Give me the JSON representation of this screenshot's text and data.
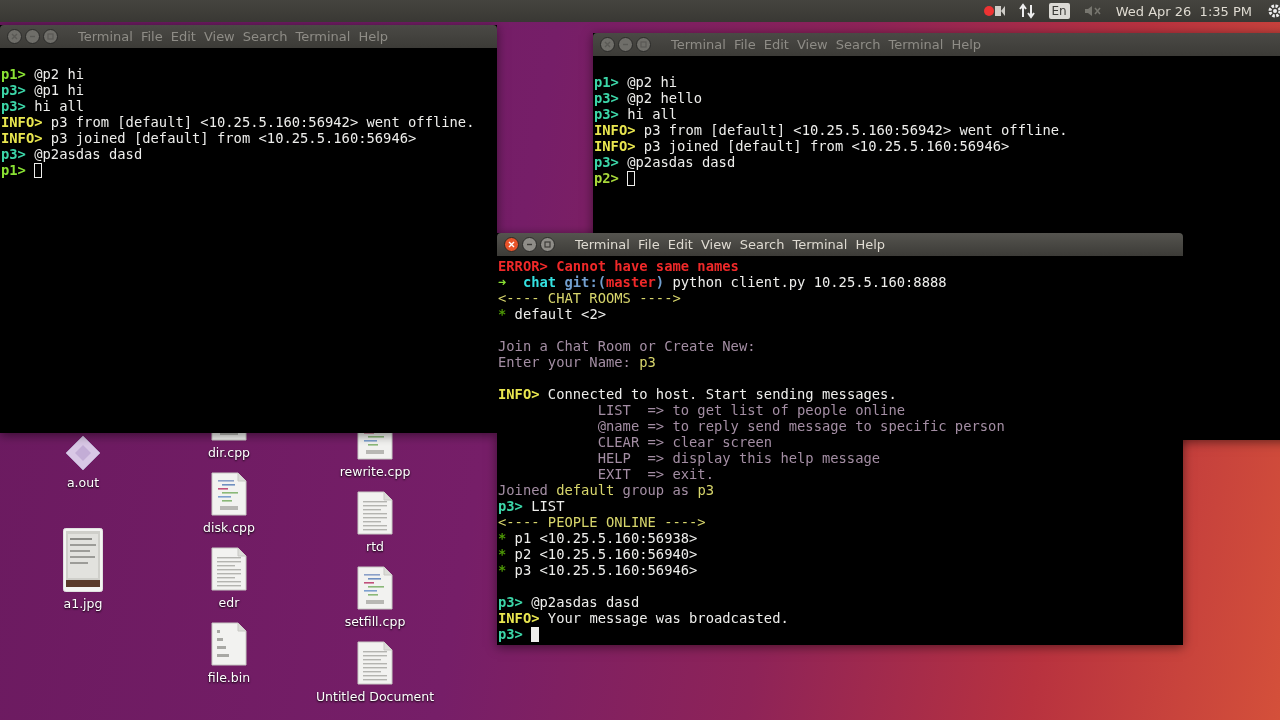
{
  "top_panel": {
    "keyboard_layout": "En",
    "clock": "Wed Apr 26  1:35 PM"
  },
  "desktop": {
    "columns": [
      [
        {
          "name": "a.out",
          "kind": "executable"
        },
        {
          "name": "a1.jpg"
        }
      ],
      [
        {
          "name": "dir.cpp",
          "kind": "cpp"
        },
        {
          "name": "disk.cpp",
          "kind": "cpp"
        },
        {
          "name": "edr",
          "kind": "text"
        },
        {
          "name": "file.bin",
          "kind": "binary"
        }
      ],
      [
        {
          "name": "rewrite.cpp",
          "kind": "cpp"
        },
        {
          "name": "rtd",
          "kind": "text"
        },
        {
          "name": "setfill.cpp",
          "kind": "cpp"
        },
        {
          "name": "Untitled Document",
          "kind": "text"
        }
      ]
    ]
  },
  "windows": [
    {
      "title": "Terminal",
      "focused": false,
      "menu": [
        "File",
        "Edit",
        "View",
        "Search",
        "Terminal",
        "Help"
      ],
      "lines": [
        {
          "kind": "output",
          "segments": [
            {
              "text": "p1>",
              "kind": "prompt",
              "color": "#8ae234"
            },
            {
              "text": " @p2 hi",
              "kind": "text",
              "color": "#eeeeec"
            }
          ]
        },
        {
          "kind": "output",
          "segments": [
            {
              "text": "p3>",
              "kind": "prompt",
              "color": "#3cd6a8"
            },
            {
              "text": " @p1 hi",
              "kind": "text",
              "color": "#eeeeec"
            }
          ]
        },
        {
          "kind": "output",
          "segments": [
            {
              "text": "p3>",
              "kind": "prompt",
              "color": "#3cd6a8"
            },
            {
              "text": " hi all",
              "kind": "text",
              "color": "#eeeeec"
            }
          ]
        },
        {
          "kind": "output",
          "segments": [
            {
              "text": "INFO>",
              "kind": "prompt",
              "color": "#e9e64f"
            },
            {
              "text": " p3 from [default] <10.25.5.160:56942> went offline.",
              "kind": "text",
              "color": "#eeeeec"
            }
          ]
        },
        {
          "kind": "output",
          "segments": [
            {
              "text": "INFO>",
              "kind": "prompt",
              "color": "#e9e64f"
            },
            {
              "text": " p3 joined [default] from <10.25.5.160:56946>",
              "kind": "text",
              "color": "#eeeeec"
            }
          ]
        },
        {
          "kind": "output",
          "segments": [
            {
              "text": "p3>",
              "kind": "prompt",
              "color": "#3cd6a8"
            },
            {
              "text": " @p2asdas dasd",
              "kind": "text",
              "color": "#eeeeec"
            }
          ]
        },
        {
          "kind": "input",
          "segments": [
            {
              "text": "p1>",
              "kind": "prompt",
              "color": "#8ae234"
            }
          ]
        }
      ]
    },
    {
      "title": "Terminal",
      "focused": false,
      "menu": [
        "File",
        "Edit",
        "View",
        "Search",
        "Terminal",
        "Help"
      ],
      "lines": [
        {
          "kind": "output",
          "segments": [
            {
              "text": "p1>",
              "kind": "prompt",
              "color": "#3cd6a8"
            },
            {
              "text": " @p2 hi",
              "kind": "text",
              "color": "#eeeeec"
            }
          ]
        },
        {
          "kind": "output",
          "segments": [
            {
              "text": "p3>",
              "kind": "prompt",
              "color": "#3cd6a8"
            },
            {
              "text": " @p2 hello",
              "kind": "text",
              "color": "#eeeeec"
            }
          ]
        },
        {
          "kind": "output",
          "segments": [
            {
              "text": "p3>",
              "kind": "prompt",
              "color": "#3cd6a8"
            },
            {
              "text": " hi all",
              "kind": "text",
              "color": "#eeeeec"
            }
          ]
        },
        {
          "kind": "output",
          "segments": [
            {
              "text": "INFO>",
              "kind": "prompt",
              "color": "#e9e64f"
            },
            {
              "text": " p3 from [default] <10.25.5.160:56942> went offline.",
              "kind": "text",
              "color": "#eeeeec"
            }
          ]
        },
        {
          "kind": "output",
          "segments": [
            {
              "text": "INFO>",
              "kind": "prompt",
              "color": "#e9e64f"
            },
            {
              "text": " p3 joined [default] from <10.25.5.160:56946>",
              "kind": "text",
              "color": "#eeeeec"
            }
          ]
        },
        {
          "kind": "output",
          "segments": [
            {
              "text": "p3>",
              "kind": "prompt",
              "color": "#3cd6a8"
            },
            {
              "text": " @p2asdas dasd",
              "kind": "text",
              "color": "#eeeeec"
            }
          ]
        },
        {
          "kind": "input",
          "segments": [
            {
              "text": "p2>",
              "kind": "prompt",
              "color": "#a8d83a"
            }
          ]
        }
      ]
    },
    {
      "title": "Terminal",
      "focused": true,
      "menu": [
        "File",
        "Edit",
        "View",
        "Search",
        "Terminal",
        "Help"
      ],
      "lines": [
        {
          "kind": "output",
          "segments": [
            {
              "text": "ERROR>",
              "kind": "prompt",
              "color": "#ef2929"
            },
            {
              "text": " Cannot have same names",
              "kind": "prompt",
              "color": "#ef2929"
            }
          ]
        },
        {
          "kind": "output",
          "segments": [
            {
              "text": "➜",
              "kind": "prompt",
              "color": "#8ae234"
            },
            {
              "text": "  chat",
              "kind": "prompt",
              "color": "#34e2e2"
            },
            {
              "text": " git:(",
              "kind": "prompt",
              "color": "#729fcf"
            },
            {
              "text": "master",
              "kind": "prompt",
              "color": "#ef2929"
            },
            {
              "text": ")",
              "kind": "prompt",
              "color": "#729fcf"
            },
            {
              "text": " python client.py 10.25.5.160:8888",
              "kind": "text",
              "color": "#eeeeec"
            }
          ]
        },
        {
          "kind": "output",
          "segments": [
            {
              "text": "<---- CHAT ROOMS ---->",
              "kind": "text",
              "color": "#d8d66c"
            }
          ]
        },
        {
          "kind": "output",
          "segments": [
            {
              "text": "*",
              "kind": "prompt",
              "color": "#4e9a06"
            },
            {
              "text": " default <2>",
              "kind": "text",
              "color": "#eeeeec"
            }
          ]
        },
        {
          "kind": "blank"
        },
        {
          "kind": "output",
          "segments": [
            {
              "text": "Join a Chat Room or Create New:",
              "kind": "text",
              "color": "#a48ea4"
            }
          ]
        },
        {
          "kind": "output",
          "segments": [
            {
              "text": "Enter your Name: ",
              "kind": "text",
              "color": "#a48ea4"
            },
            {
              "text": "p3",
              "kind": "text",
              "color": "#d8d66c"
            }
          ]
        },
        {
          "kind": "blank"
        },
        {
          "kind": "output",
          "segments": [
            {
              "text": "INFO>",
              "kind": "prompt",
              "color": "#e9e64f"
            },
            {
              "text": " Connected to host. Start sending messages.",
              "kind": "text",
              "color": "#eeeeec"
            }
          ]
        },
        {
          "kind": "output",
          "segments": [
            {
              "text": "            LIST  => to get list of people online",
              "kind": "text",
              "color": "#a48ea4"
            }
          ]
        },
        {
          "kind": "output",
          "segments": [
            {
              "text": "            @name => to reply send message to specific person",
              "kind": "text",
              "color": "#a48ea4"
            }
          ]
        },
        {
          "kind": "output",
          "segments": [
            {
              "text": "            CLEAR => clear screen",
              "kind": "text",
              "color": "#a48ea4"
            }
          ]
        },
        {
          "kind": "output",
          "segments": [
            {
              "text": "            HELP  => display this help message",
              "kind": "text",
              "color": "#a48ea4"
            }
          ]
        },
        {
          "kind": "output",
          "segments": [
            {
              "text": "            EXIT  => exit.",
              "kind": "text",
              "color": "#a48ea4"
            }
          ]
        },
        {
          "kind": "output",
          "segments": [
            {
              "text": "Joined ",
              "kind": "text",
              "color": "#a48ea4"
            },
            {
              "text": "default",
              "kind": "text",
              "color": "#d8d66c"
            },
            {
              "text": " group as ",
              "kind": "text",
              "color": "#a48ea4"
            },
            {
              "text": "p3",
              "kind": "text",
              "color": "#d8d66c"
            }
          ]
        },
        {
          "kind": "output",
          "segments": [
            {
              "text": "p3>",
              "kind": "prompt",
              "color": "#3cd6a8"
            },
            {
              "text": " LIST",
              "kind": "text",
              "color": "#eeeeec"
            }
          ]
        },
        {
          "kind": "output",
          "segments": [
            {
              "text": "<---- PEOPLE ONLINE ---->",
              "kind": "text",
              "color": "#d8d66c"
            }
          ]
        },
        {
          "kind": "output",
          "segments": [
            {
              "text": "*",
              "kind": "prompt",
              "color": "#4e9a06"
            },
            {
              "text": " p1 <10.25.5.160:56938>",
              "kind": "text",
              "color": "#eeeeec"
            }
          ]
        },
        {
          "kind": "output",
          "segments": [
            {
              "text": "*",
              "kind": "prompt",
              "color": "#4e9a06"
            },
            {
              "text": " p2 <10.25.5.160:56940>",
              "kind": "text",
              "color": "#eeeeec"
            }
          ]
        },
        {
          "kind": "output",
          "segments": [
            {
              "text": "*",
              "kind": "prompt",
              "color": "#4e9a06"
            },
            {
              "text": " p3 <10.25.5.160:56946>",
              "kind": "text",
              "color": "#eeeeec"
            }
          ]
        },
        {
          "kind": "blank"
        },
        {
          "kind": "output",
          "segments": [
            {
              "text": "p3>",
              "kind": "prompt",
              "color": "#3cd6a8"
            },
            {
              "text": " @p2asdas dasd",
              "kind": "text",
              "color": "#eeeeec"
            }
          ]
        },
        {
          "kind": "output",
          "segments": [
            {
              "text": "INFO>",
              "kind": "prompt",
              "color": "#e9e64f"
            },
            {
              "text": " Your message was broadcasted.",
              "kind": "text",
              "color": "#eeeeec"
            }
          ]
        },
        {
          "kind": "input",
          "segments": [
            {
              "text": "p3>",
              "kind": "prompt",
              "color": "#3cd6a8"
            }
          ]
        }
      ]
    }
  ]
}
